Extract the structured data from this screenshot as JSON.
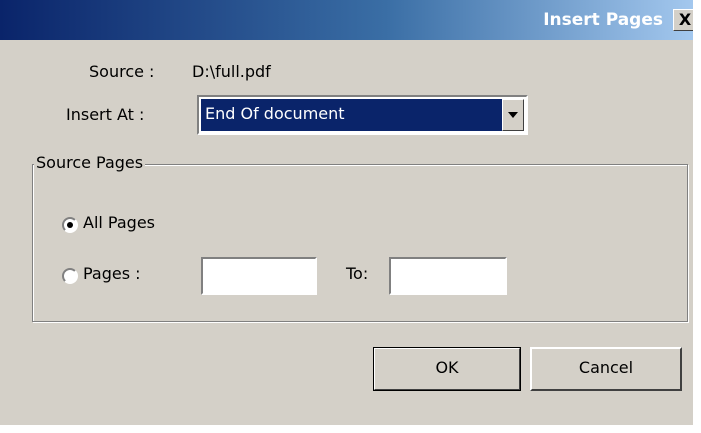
{
  "dialog": {
    "title": "Insert Pages",
    "close_glyph": "X"
  },
  "source": {
    "label": "Source :",
    "value": "D:\\full.pdf"
  },
  "insert_at": {
    "label": "Insert At :",
    "selected": "End Of document"
  },
  "source_pages": {
    "legend": "Source Pages",
    "all_pages_label": "All Pages",
    "pages_label": "Pages :",
    "to_label": "To:",
    "from_value": "",
    "to_value": "",
    "selected_option": "All Pages"
  },
  "buttons": {
    "ok": "OK",
    "cancel": "Cancel"
  },
  "icons": {
    "close": "close-icon",
    "dropdown": "chevron-down-icon"
  }
}
